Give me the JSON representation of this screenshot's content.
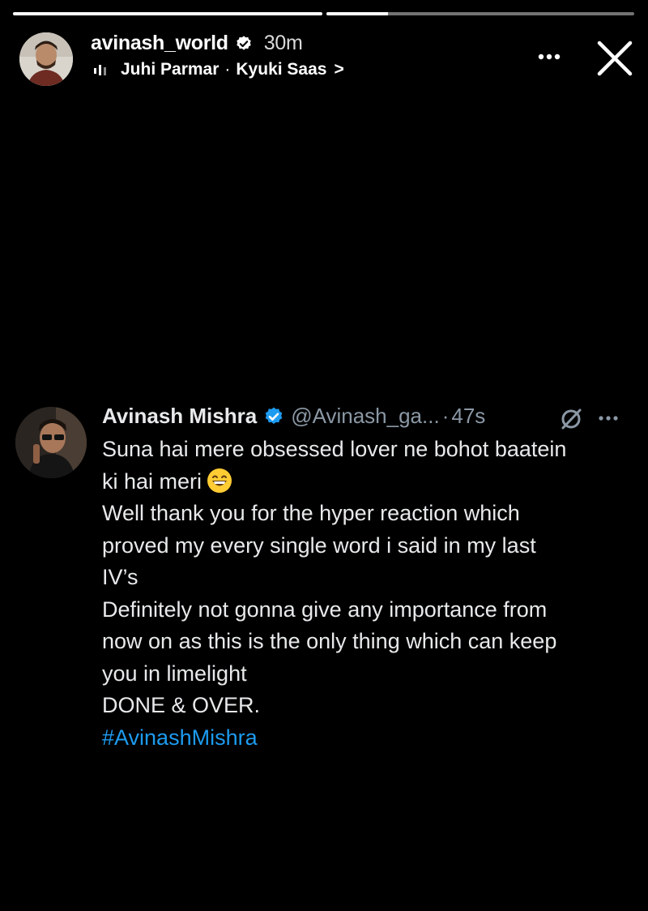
{
  "story": {
    "progress": [
      1.0,
      0.2
    ],
    "username": "avinash_world",
    "posted_ago": "30m",
    "music": {
      "artist": "Juhi Parmar",
      "separator": "·",
      "song": "Kyuki Saas",
      "chevron": ">"
    },
    "icons": {
      "more": "more-horizontal-icon",
      "close": "close-icon",
      "verified": "verified-badge-icon",
      "music": "audio-wave-icon"
    }
  },
  "tweet": {
    "name": "Avinash Mishra",
    "handle": "@Avinash_ga...",
    "dot": "·",
    "age": "47s",
    "lines": [
      "Suna hai mere obsessed lover ne bohot baatein",
      "ki hai meri",
      "Well thank you for the hyper reaction which",
      "proved my every single word i said in my last",
      "IV’s",
      "Definitely not gonna give any importance from",
      "now on as this is the only thing which can keep",
      "you in limelight",
      "DONE & OVER."
    ],
    "hashtag": "#AvinashMishra",
    "emoji": "grinning-face-emoji",
    "icons": {
      "grok": "grok-icon",
      "more": "more-horizontal-icon",
      "verified": "verified-badge-icon"
    }
  },
  "colors": {
    "background": "#000000",
    "text": "#e7e9ea",
    "muted": "#8b98a5",
    "link": "#1d9bf0",
    "verified": "#1d9bf0"
  }
}
